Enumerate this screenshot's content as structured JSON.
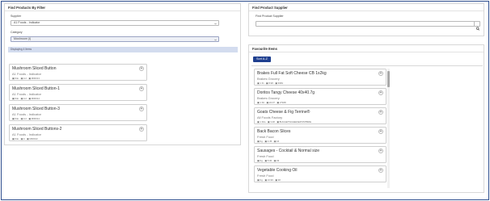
{
  "filter_panel": {
    "title": "Find Products By Filter",
    "supplier_label": "Supplier",
    "supplier_value": "A1 Foods - Indicator",
    "category_label": "Category",
    "category_value": "Mushroom (i)",
    "info_text": "Displaying 4 Items",
    "results": [
      {
        "name": "Mushroom Sliced Button",
        "supplier": "A1 Foods - Indicator",
        "meta": "▣ Kilo · ▣ 4.2 · ▣ M00013"
      },
      {
        "name": "Mushroom Sliced Button-1",
        "supplier": "A1 Foods - Indicator",
        "meta": "▣ Kilo · ▣ 4.2 · ▣ M00014"
      },
      {
        "name": "Mushroom Sliced Button-3",
        "supplier": "A1 Foods - Indicator",
        "meta": "▣ Kilo · ▣ 4.2 · ▣ M00014"
      },
      {
        "name": "Mushroom Sliced Buttons-2",
        "supplier": "A1 Foods - Indicator",
        "meta": "▣ Kilo · ▣ 4 · ▣ M00013"
      }
    ],
    "add_label": "+"
  },
  "supplier_panel": {
    "title": "Find Product Supplier",
    "field_label": "Find Product Supplier",
    "field_value": "",
    "field_placeholder": ""
  },
  "favourites_panel": {
    "title": "Favourite Items",
    "sort_label": "Sort A-Z",
    "items": [
      {
        "name": "Brakes Full Fat Soft Cheese CB 1x2kg",
        "supplier": "Brakes Grocery",
        "meta": "▣ 1 Kt · ▣ 8.98 · ▣ 3969"
      },
      {
        "name": "Doritos Tangy Cheese 40x40.7g",
        "supplier": "Brakes Grocery",
        "meta": "▣ 1 Kit · ▣ 22.07 · ▣ 27468"
      },
      {
        "name": "Goats Cheese & Fig Terrine®",
        "supplier": "All Foods Factory",
        "meta": "▣ 1 Kilo · ▣ 3.48 · ▣ BUGGETSCHEESEPOSTBRIE"
      },
      {
        "name": "Back Bacon Slices",
        "supplier": "Fresh Food",
        "meta": "▣ Kg · ▣ 4.35 · ▣ 16"
      },
      {
        "name": "Sausages - Cocktail & Normal size",
        "supplier": "Fresh Food",
        "meta": "▣ Kg · ▣ 5.00 · ▣ 33"
      },
      {
        "name": "Vegetable Cooking Oil",
        "supplier": "Fresh Food",
        "meta": "▣ Kg · ▣ 13.99 · ▣ 38"
      }
    ],
    "add_label": "+"
  },
  "colors": {
    "accent": "#1f3f8f",
    "info_bar": "#d3dcef",
    "frame": "#2f4f8f"
  }
}
